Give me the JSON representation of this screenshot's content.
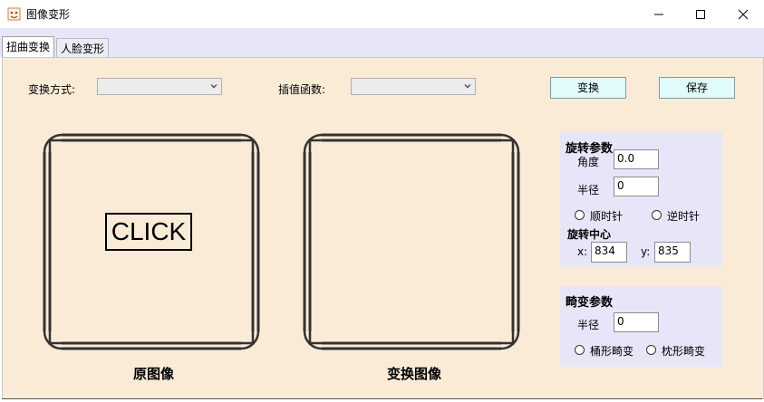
{
  "window": {
    "title": "图像变形",
    "icon": "app-icon",
    "controls": [
      "minimize-icon",
      "maximize-icon",
      "close-icon"
    ]
  },
  "tabs": [
    {
      "label": "扭曲变换",
      "active": true
    },
    {
      "label": "人脸变形",
      "active": false
    }
  ],
  "toolbar": {
    "transform_mode_label": "变换方式:",
    "transform_mode_value": "",
    "interp_label": "插值函数:",
    "interp_value": "",
    "transform_button": "变换",
    "save_button": "保存"
  },
  "images": {
    "original_caption": "原图像",
    "original_text": "CLICK",
    "transformed_caption": "变换图像"
  },
  "rotation": {
    "title": "旋转参数",
    "angle_label": "角度",
    "angle_value": "0.0",
    "radius_label": "半径",
    "radius_value": "0",
    "clockwise_label": "顺时针",
    "counterclockwise_label": "逆时针",
    "center_title": "旋转中心",
    "x_label": "x:",
    "x_value": "834",
    "y_label": "y:",
    "y_value": "835"
  },
  "distortion": {
    "title": "畸变参数",
    "radius_label": "半径",
    "radius_value": "0",
    "barrel_label": "桶形畸变",
    "pincushion_label": "枕形畸变"
  },
  "colors": {
    "panel_bg": "#faebd7",
    "group_bg": "#e6e6f8",
    "button_bg": "#e1fbfb"
  }
}
